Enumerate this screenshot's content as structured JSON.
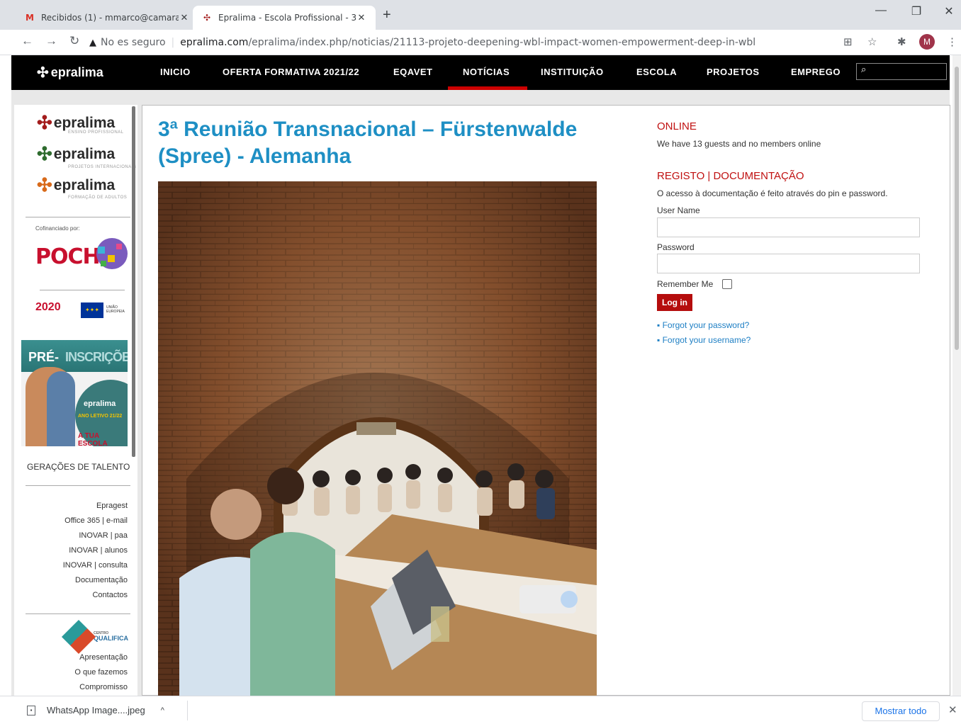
{
  "browser": {
    "tabs": [
      {
        "label": "Recibidos (1) - mmarco@camara",
        "favicon": "gmail-icon"
      },
      {
        "label": "Epralima - Escola Profissional - 3",
        "favicon": "epralima-icon"
      }
    ],
    "address": {
      "security_label": "No es seguro",
      "host": "epralima.com",
      "path": "/epralima/index.php/noticias/21113-projeto-deepening-wbl-impact-women-empowerment-deep-in-wbl"
    },
    "profile_initial": "M"
  },
  "site": {
    "logo_text": "epralima",
    "nav": [
      "INICIO",
      "OFERTA FORMATIVA 2021/22",
      "EQAVET",
      "NOTÍCIAS",
      "INSTITUIÇÃO",
      "ESCOLA",
      "PROJETOS",
      "EMPREGO"
    ],
    "active_nav": "NOTÍCIAS",
    "accent": "#cc0000"
  },
  "sidebar": {
    "brands": [
      {
        "name": "epralima",
        "tag": "ENSINO PROFISSIONAL"
      },
      {
        "name": "epralima",
        "tag": "PROJETOS INTERNACIONAIS"
      },
      {
        "name": "epralima",
        "tag": "FORMAÇÃO DE ADULTOS"
      }
    ],
    "cofinanciado": "Cofinanciado por:",
    "poch": "POCH",
    "portugal2020": "2020",
    "eu_label": "UNIÃO EUROPEIA",
    "banner": {
      "pre": "PRÉ-",
      "inscricoes": "INSCRIÇÕES",
      "brand": "epralima",
      "ano": "ANO LETIVO 21/22",
      "tua": "A TUA ESCOLA"
    },
    "geracoes": "GERAÇÕES DE TALENTO",
    "links": [
      "Epragest",
      "Office 365 | e-mail",
      "INOVAR | paa",
      "INOVAR | alunos",
      "INOVAR | consulta",
      "Documentação",
      "Contactos"
    ],
    "qualifica": {
      "top": "CENTRO",
      "name": "QUALIFICA"
    },
    "qualifica_links": [
      "Apresentação",
      "O que fazemos",
      "Compromisso"
    ]
  },
  "article": {
    "title": "3ª Reunião Transnacional – Fürstenwalde (Spree) - Alemanha"
  },
  "online": {
    "heading": "ONLINE",
    "text": "We have 13 guests and no members online"
  },
  "registo": {
    "heading": "REGISTO | DOCUMENTAÇÃO",
    "intro": "O acesso à documentação é feito através do pin e password.",
    "username_label": "User Name",
    "password_label": "Password",
    "remember_label": "Remember Me",
    "login_label": "Log in",
    "forgot_password": "Forgot your password?",
    "forgot_username": "Forgot your username?"
  },
  "downloads": {
    "file": "WhatsApp Image....jpeg",
    "show_all": "Mostrar todo"
  }
}
